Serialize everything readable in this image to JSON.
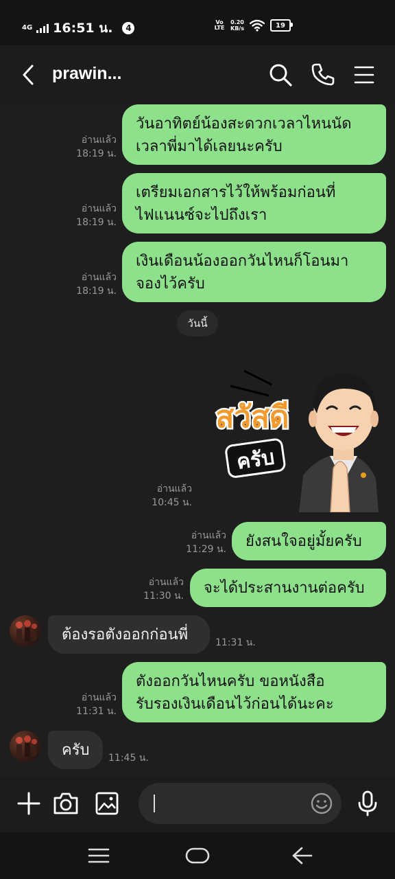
{
  "status_bar": {
    "network": "4G",
    "time": "16:51 น.",
    "notification_count": "4",
    "volte": "Vo LTE",
    "speed_value": "0.20",
    "speed_unit": "KB/s",
    "battery": "19"
  },
  "header": {
    "title": "prawin..."
  },
  "messages": [
    {
      "direction": "out",
      "lines": [
        "วันอาทิตย์น้องสะดวกเวลาไหนนัด",
        "เวลาพี่มาได้เลยนะครับ"
      ],
      "read": "อ่านแล้ว",
      "time": "18:19 น."
    },
    {
      "direction": "out",
      "lines": [
        "เตรียมเอกสารไว้ให้พร้อมก่อนที่",
        "ไฟแนนซ์จะไปถึงเรา"
      ],
      "read": "อ่านแล้ว",
      "time": "18:19 น."
    },
    {
      "direction": "out",
      "lines": [
        "เงินเดือนน้องออกวันไหนก็โอนมา",
        "จองไว้ครับ"
      ],
      "read": "อ่านแล้ว",
      "time": "18:19 น."
    },
    {
      "direction": "sticker",
      "sticker_text_top": "สวัสดี",
      "sticker_text_bottom": "ครับ",
      "read": "อ่านแล้ว",
      "time": "10:45 น."
    },
    {
      "direction": "out",
      "lines": [
        "ยังสนใจอยู่มั้ยครับ"
      ],
      "read": "อ่านแล้ว",
      "time": "11:29 น."
    },
    {
      "direction": "out",
      "lines": [
        "จะได้ประสานงานต่อครับ"
      ],
      "read": "อ่านแล้ว",
      "time": "11:30 น."
    },
    {
      "direction": "in",
      "lines": [
        "ต้องรอตังออกก่อนพี่"
      ],
      "time": "11:31 น."
    },
    {
      "direction": "out",
      "lines": [
        "ตังออกวันไหนครับ ขอหนังสือ",
        "รับรองเงินเดือนไว้ก่อนได้นะคะ"
      ],
      "read": "อ่านแล้ว",
      "time": "11:31 น."
    },
    {
      "direction": "in",
      "lines": [
        "ครับ"
      ],
      "time": "11:45 น."
    }
  ],
  "date_separator": "วันนี้",
  "composer": {
    "placeholder": ""
  },
  "colors": {
    "outgoing_bubble": "#8de18a",
    "incoming_bubble": "#2f2f2f",
    "background": "#1e1e1e"
  }
}
